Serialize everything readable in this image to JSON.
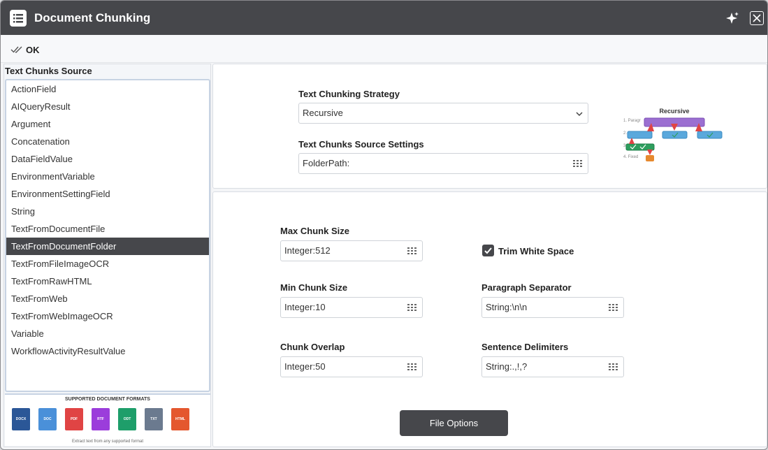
{
  "window": {
    "title": "Document Chunking",
    "icons": {
      "app": "list-icon",
      "ai": "sparkle-icon",
      "close": "close-icon"
    }
  },
  "toolbar": {
    "ok_label": "OK",
    "ok_icon": "double-check-icon"
  },
  "source_panel": {
    "title": "Text Chunks Source",
    "items": [
      "ActionField",
      "AIQueryResult",
      "Argument",
      "Concatenation",
      "DataFieldValue",
      "EnvironmentVariable",
      "EnvironmentSettingField",
      "String",
      "TextFromDocumentFile",
      "TextFromDocumentFolder",
      "TextFromFileImageOCR",
      "TextFromRawHTML",
      "TextFromWeb",
      "TextFromWebImageOCR",
      "Variable",
      "WorkflowActivityResultValue"
    ],
    "selected": "TextFromDocumentFolder",
    "formats": {
      "title": "SUPPORTED DOCUMENT FORMATS",
      "items": [
        {
          "label": "DOCX",
          "color": "#2b5797"
        },
        {
          "label": "DOC",
          "color": "#4a90d9"
        },
        {
          "label": "PDF",
          "color": "#e04444"
        },
        {
          "label": "RTF",
          "color": "#9b3ddb"
        },
        {
          "label": "ODT",
          "color": "#1e9e6a"
        },
        {
          "label": "TXT",
          "color": "#6b7a8f"
        },
        {
          "label": "HTML",
          "color": "#e4572e"
        }
      ],
      "note": "Extract text from any supported format"
    }
  },
  "strategy": {
    "label": "Text Chunking Strategy",
    "value": "Recursive",
    "source_settings_label": "Text Chunks Source Settings",
    "source_settings_value": "FolderPath:",
    "diagram": {
      "title": "Recursive",
      "steps": [
        "1. Paragr",
        "2.",
        "3.",
        "4. Fixed"
      ]
    }
  },
  "settings": {
    "max_chunk_size": {
      "label": "Max Chunk Size",
      "value": "Integer:512"
    },
    "min_chunk_size": {
      "label": "Min Chunk Size",
      "value": "Integer:10"
    },
    "chunk_overlap": {
      "label": "Chunk Overlap",
      "value": "Integer:50"
    },
    "trim_white_space": {
      "label": "Trim White Space",
      "checked": true
    },
    "paragraph_separator": {
      "label": "Paragraph Separator",
      "value": "String:\\n\\n"
    },
    "sentence_delimiters": {
      "label": "Sentence Delimiters",
      "value": "String:.,!,?"
    }
  },
  "file_options_label": "File Options",
  "colors": {
    "dark": "#46474b",
    "accent_border": "#c7d3e3"
  }
}
